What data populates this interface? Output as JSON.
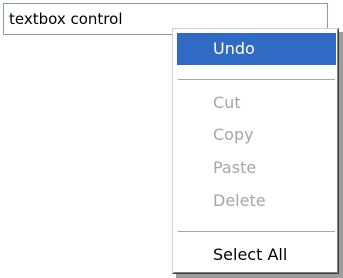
{
  "textbox": {
    "value": "textbox control"
  },
  "context_menu": {
    "items": [
      {
        "label": "Undo",
        "state": "highlighted"
      },
      {
        "label": "Cut",
        "state": "disabled"
      },
      {
        "label": "Copy",
        "state": "disabled"
      },
      {
        "label": "Paste",
        "state": "disabled"
      },
      {
        "label": "Delete",
        "state": "disabled"
      },
      {
        "label": "Select All",
        "state": "enabled"
      }
    ],
    "colors": {
      "highlight": "#316ac5",
      "disabled_text": "#a7a6aa"
    }
  }
}
